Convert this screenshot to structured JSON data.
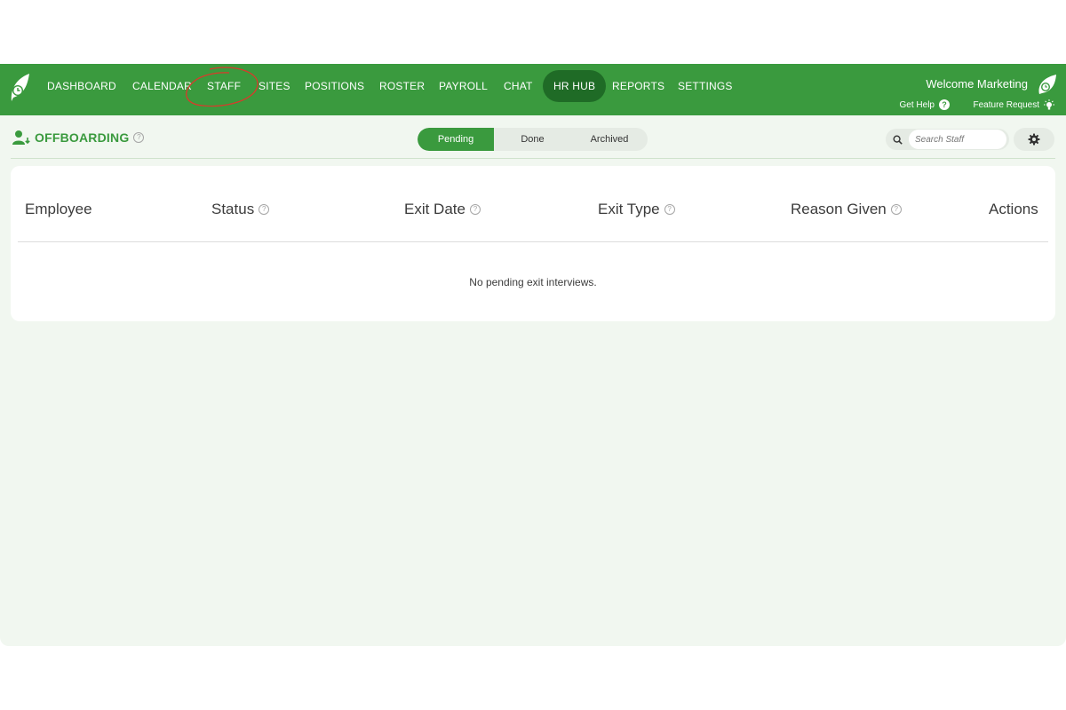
{
  "nav": {
    "items": [
      {
        "label": "DASHBOARD",
        "active": false
      },
      {
        "label": "CALENDAR",
        "active": false
      },
      {
        "label": "STAFF",
        "active": false
      },
      {
        "label": "SITES",
        "active": false
      },
      {
        "label": "POSITIONS",
        "active": false
      },
      {
        "label": "ROSTER",
        "active": false
      },
      {
        "label": "PAYROLL",
        "active": false
      },
      {
        "label": "CHAT",
        "active": false
      },
      {
        "label": "HR HUB",
        "active": true
      },
      {
        "label": "REPORTS",
        "active": false
      },
      {
        "label": "SETTINGS",
        "active": false
      }
    ],
    "welcome": "Welcome Marketing",
    "help": "Get Help",
    "feature_request": "Feature Request"
  },
  "page": {
    "title": "OFFBOARDING",
    "tabs": [
      {
        "label": "Pending",
        "active": true
      },
      {
        "label": "Done",
        "active": false
      },
      {
        "label": "Archived",
        "active": false
      }
    ],
    "search_placeholder": "Search Staff"
  },
  "table": {
    "columns": [
      {
        "label": "Employee",
        "info": false
      },
      {
        "label": "Status",
        "info": true
      },
      {
        "label": "Exit Date",
        "info": true
      },
      {
        "label": "Exit Type",
        "info": true
      },
      {
        "label": "Reason Given",
        "info": true
      },
      {
        "label": "Actions",
        "info": false
      }
    ],
    "empty_message": "No pending exit interviews."
  },
  "colors": {
    "brand_green": "#3a9a3e",
    "active_nav": "#1f6b26",
    "annotation_red": "#d93a2b",
    "page_bg": "#f1f7f0"
  }
}
